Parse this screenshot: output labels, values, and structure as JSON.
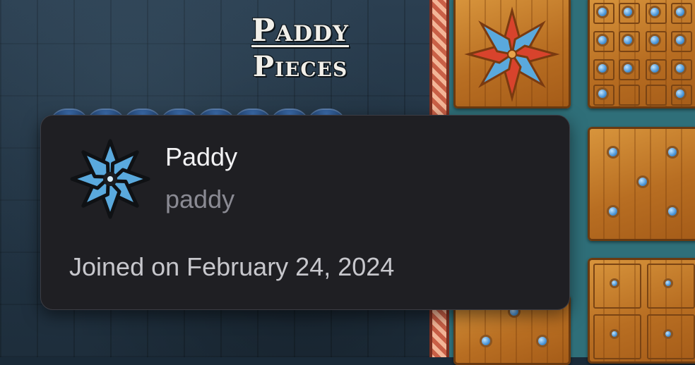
{
  "page": {
    "title_line1": "Paddy",
    "title_line2": "Pieces"
  },
  "profile_card": {
    "display_name": "Paddy",
    "username": "paddy",
    "joined_text": "Joined on February 24, 2024",
    "avatar_icon": "blue-rosette-icon"
  },
  "colors": {
    "card_bg": "#1f1f23",
    "name_color": "#f2f2f4",
    "handle_color": "#8a8a93",
    "avatar_petal": "#5aa9dd",
    "rosette_red": "#d8432c",
    "rosette_blue": "#5aa9dd",
    "board_teal": "#2f6f79"
  }
}
